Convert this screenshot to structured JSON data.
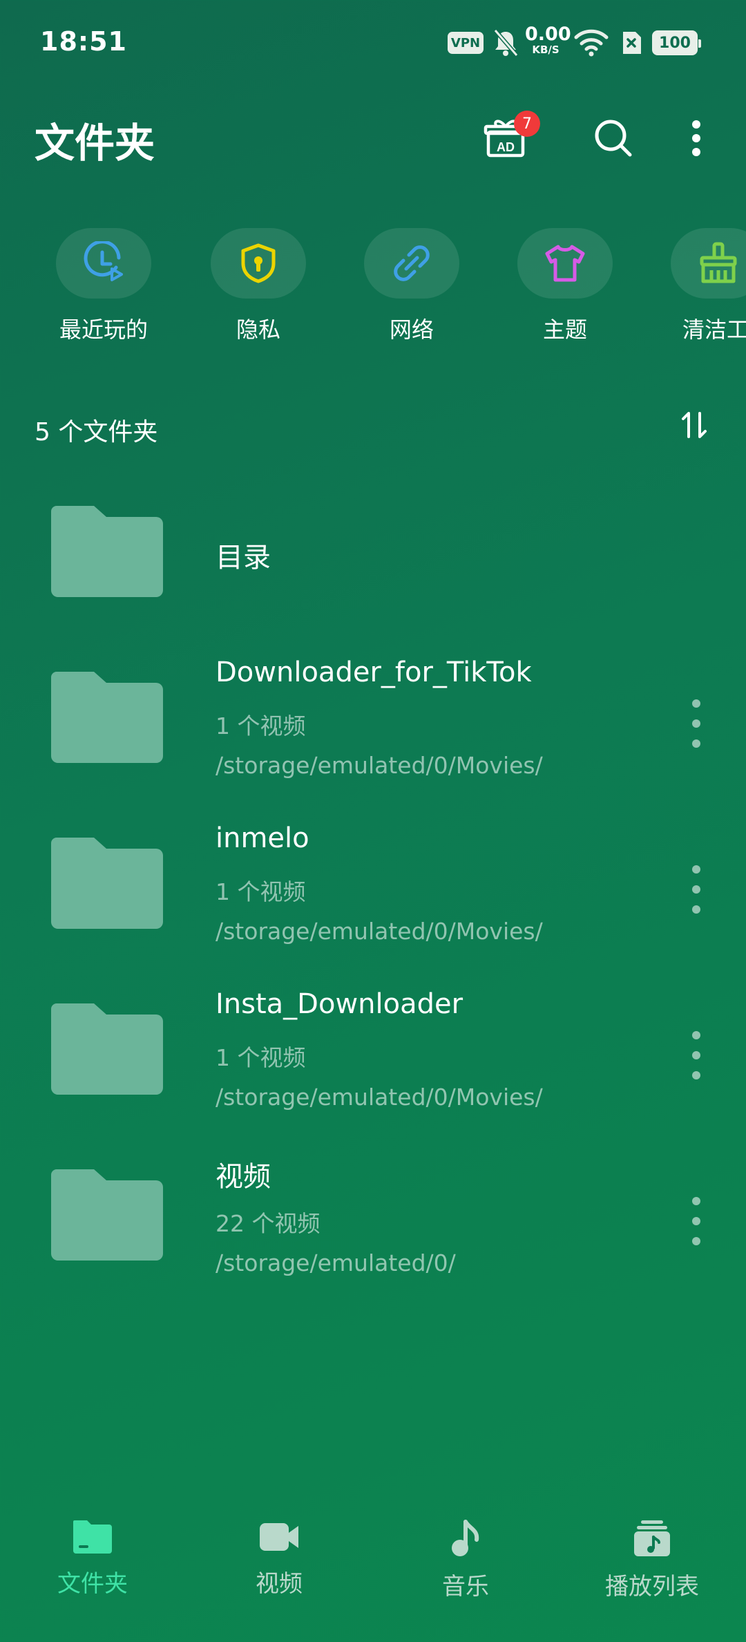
{
  "status_bar": {
    "time": "18:51",
    "vpn": "VPN",
    "speed_value": "0.00",
    "speed_unit": "KB/S",
    "battery": "100"
  },
  "header": {
    "title": "文件夹",
    "gift_badge": "7",
    "ad_label": "AD"
  },
  "shortcuts": [
    {
      "label": "最近玩的",
      "icon": "recent-play-icon",
      "color": "#3fa0e6"
    },
    {
      "label": "隐私",
      "icon": "shield-lock-icon",
      "color": "#ecd400"
    },
    {
      "label": "网络",
      "icon": "link-icon",
      "color": "#3fa0e6"
    },
    {
      "label": "主题",
      "icon": "tshirt-icon",
      "color": "#d65be6"
    },
    {
      "label": "清洁工",
      "icon": "broom-icon",
      "color": "#7fd14b"
    }
  ],
  "folders_header": {
    "count_label": "5 个文件夹"
  },
  "folders": [
    {
      "name": "目录",
      "count": "",
      "path": ""
    },
    {
      "name": "Downloader_for_TikTok",
      "count": "1 个视频",
      "path": "/storage/emulated/0/Movies/"
    },
    {
      "name": "inmelo",
      "count": "1 个视频",
      "path": "/storage/emulated/0/Movies/"
    },
    {
      "name": "Insta_Downloader",
      "count": "1 个视频",
      "path": "/storage/emulated/0/Movies/"
    },
    {
      "name": "视频",
      "count": "22 个视频",
      "path": "/storage/emulated/0/"
    }
  ],
  "bottom_nav": [
    {
      "label": "文件夹",
      "active": true
    },
    {
      "label": "视频",
      "active": false
    },
    {
      "label": "音乐",
      "active": false
    },
    {
      "label": "播放列表",
      "active": false
    }
  ],
  "colors": {
    "accent": "#3fe2a6",
    "folder": "#6bb59a",
    "inactive_nav": "#b9d9cb",
    "badge": "#f03a3a"
  }
}
